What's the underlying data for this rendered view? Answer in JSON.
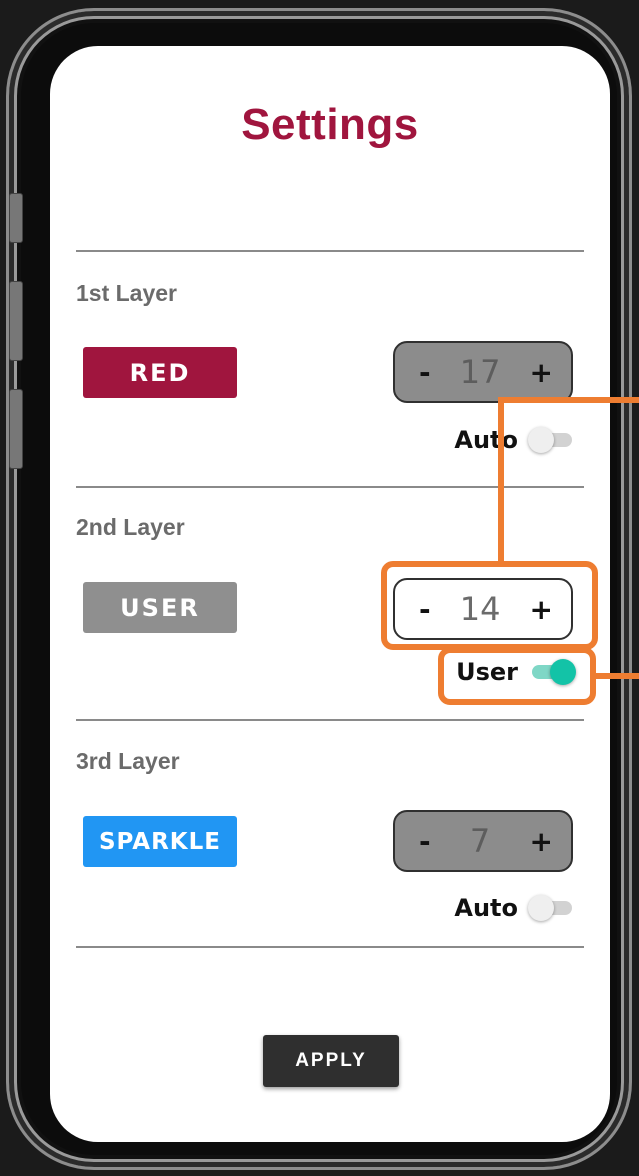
{
  "app": {
    "title": "Settings"
  },
  "layers": [
    {
      "label": "1st Layer",
      "mode": "RED",
      "mode_color": "#a0153e",
      "value": "17",
      "toggle_label": "Auto",
      "toggle_on": false,
      "stepper_enabled": false
    },
    {
      "label": "2nd Layer",
      "mode": "USER",
      "mode_color": "#8f8f8f",
      "value": "14",
      "toggle_label": "User",
      "toggle_on": true,
      "stepper_enabled": true
    },
    {
      "label": "3rd Layer",
      "mode": "SPARKLE",
      "mode_color": "#2196f3",
      "value": "7",
      "toggle_label": "Auto",
      "toggle_on": false,
      "stepper_enabled": false
    }
  ],
  "stepper": {
    "minus": "-",
    "plus": "+"
  },
  "apply_label": "APPLY",
  "colors": {
    "accent": "#a0153e",
    "highlight": "#ee7d31",
    "toggle_on": "#13c3a7",
    "apply_bg": "#2f2f2f"
  }
}
